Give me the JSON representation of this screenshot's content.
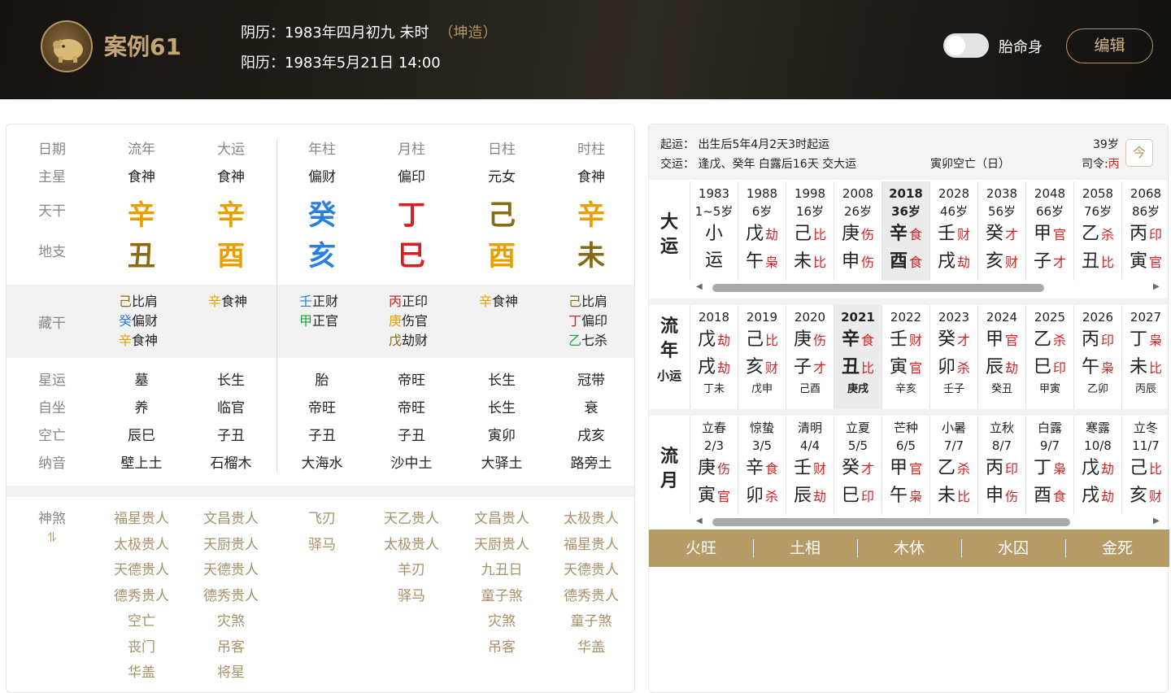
{
  "header": {
    "title": "案例61",
    "lunar": "阴历：1983年四月初九 未时",
    "gender": "（坤造）",
    "solar": "阳历：1983年5月21日 14:00",
    "toggle_label": "胎命身",
    "edit_label": "编辑"
  },
  "chart": {
    "labels": {
      "date": "日期",
      "main_star": "主星",
      "stem": "天干",
      "branch": "地支",
      "hidden": "藏干",
      "star_luck": "星运",
      "self_seat": "自坐",
      "void": "空亡",
      "nayin": "纳音",
      "shensha": "神煞",
      "shensha_icon": "⥮"
    },
    "columns": [
      {
        "head": "流年",
        "main": "食神",
        "stem": "辛",
        "stem_color": "#e8a000",
        "branch": "丑",
        "branch_color": "#8a6a10",
        "hidden": [
          {
            "g": "己",
            "ten": "比肩",
            "c": "#8a6a10"
          },
          {
            "g": "癸",
            "ten": "偏财",
            "c": "#2a7fe0"
          },
          {
            "g": "辛",
            "ten": "食神",
            "c": "#e8a000"
          }
        ],
        "star": "墓",
        "self": "养",
        "void": "辰巳",
        "nayin": "壁上土",
        "shensha": [
          "福星贵人",
          "太极贵人",
          "天德贵人",
          "德秀贵人",
          "空亡",
          "丧门",
          "华盖"
        ]
      },
      {
        "head": "大运",
        "main": "食神",
        "stem": "辛",
        "stem_color": "#e8a000",
        "branch": "酉",
        "branch_color": "#e8a000",
        "hidden": [
          {
            "g": "辛",
            "ten": "食神",
            "c": "#e8a000"
          }
        ],
        "star": "长生",
        "self": "临官",
        "void": "子丑",
        "nayin": "石榴木",
        "shensha": [
          "文昌贵人",
          "天厨贵人",
          "天德贵人",
          "德秀贵人",
          "灾煞",
          "吊客",
          "将星"
        ]
      },
      {
        "head": "年柱",
        "main": "偏财",
        "stem": "癸",
        "stem_color": "#2a7fe0",
        "branch": "亥",
        "branch_color": "#2a7fe0",
        "hidden": [
          {
            "g": "壬",
            "ten": "正财",
            "c": "#2a7fe0"
          },
          {
            "g": "甲",
            "ten": "正官",
            "c": "#1aa83c"
          }
        ],
        "star": "胎",
        "self": "帝旺",
        "void": "子丑",
        "nayin": "大海水",
        "shensha": [
          "飞刃",
          "驿马"
        ]
      },
      {
        "head": "月柱",
        "main": "偏印",
        "stem": "丁",
        "stem_color": "#d62020",
        "branch": "巳",
        "branch_color": "#d62020",
        "hidden": [
          {
            "g": "丙",
            "ten": "正印",
            "c": "#d62020"
          },
          {
            "g": "庚",
            "ten": "伤官",
            "c": "#e8a000"
          },
          {
            "g": "戊",
            "ten": "劫财",
            "c": "#8a6a10"
          }
        ],
        "star": "帝旺",
        "self": "帝旺",
        "void": "子丑",
        "nayin": "沙中土",
        "shensha": [
          "天乙贵人",
          "太极贵人",
          "羊刃",
          "驿马"
        ]
      },
      {
        "head": "日柱",
        "main": "元女",
        "stem": "己",
        "stem_color": "#8a6a10",
        "branch": "酉",
        "branch_color": "#e8a000",
        "hidden": [
          {
            "g": "辛",
            "ten": "食神",
            "c": "#e8a000"
          }
        ],
        "star": "长生",
        "self": "长生",
        "void": "寅卯",
        "nayin": "大驿土",
        "shensha": [
          "文昌贵人",
          "天厨贵人",
          "九丑日",
          "童子煞",
          "灾煞",
          "吊客"
        ]
      },
      {
        "head": "时柱",
        "main": "食神",
        "stem": "辛",
        "stem_color": "#e8a000",
        "branch": "未",
        "branch_color": "#8a6a10",
        "hidden": [
          {
            "g": "己",
            "ten": "比肩",
            "c": "#8a6a10"
          },
          {
            "g": "丁",
            "ten": "偏印",
            "c": "#d62020"
          },
          {
            "g": "乙",
            "ten": "七杀",
            "c": "#1aa83c"
          }
        ],
        "star": "冠带",
        "self": "衰",
        "void": "戌亥",
        "nayin": "路旁土",
        "shensha": [
          "太极贵人",
          "福星贵人",
          "天德贵人",
          "德秀贵人",
          "童子煞",
          "华盖"
        ]
      }
    ]
  },
  "fortune": {
    "qiyun": "起运：  出生后5年4月2天3时起运",
    "jiaoyun": "交运：  逢戊、癸年 白露后16天 交大运",
    "kongwang": "寅卯空亡（日）",
    "age": "39岁",
    "siling_label": "司令:",
    "siling_value": "丙",
    "cal_icon": "今",
    "dayun_label": [
      "大",
      "运"
    ],
    "dayun": [
      {
        "y": "1983",
        "a": "1~5岁",
        "g1": "小",
        "s1": "",
        "g2": "运",
        "s2": ""
      },
      {
        "y": "1988",
        "a": "6岁",
        "g1": "戊",
        "s1": "劫",
        "g2": "午",
        "s2": "枭"
      },
      {
        "y": "1998",
        "a": "16岁",
        "g1": "己",
        "s1": "比",
        "g2": "未",
        "s2": "比"
      },
      {
        "y": "2008",
        "a": "26岁",
        "g1": "庚",
        "s1": "伤",
        "g2": "申",
        "s2": "伤"
      },
      {
        "y": "2018",
        "a": "36岁",
        "g1": "辛",
        "s1": "食",
        "g2": "酉",
        "s2": "食",
        "cur": true
      },
      {
        "y": "2028",
        "a": "46岁",
        "g1": "壬",
        "s1": "财",
        "g2": "戌",
        "s2": "劫"
      },
      {
        "y": "2038",
        "a": "56岁",
        "g1": "癸",
        "s1": "才",
        "g2": "亥",
        "s2": "财"
      },
      {
        "y": "2048",
        "a": "66岁",
        "g1": "甲",
        "s1": "官",
        "g2": "子",
        "s2": "才"
      },
      {
        "y": "2058",
        "a": "76岁",
        "g1": "乙",
        "s1": "杀",
        "g2": "丑",
        "s2": "比"
      },
      {
        "y": "2068",
        "a": "86岁",
        "g1": "丙",
        "s1": "印",
        "g2": "寅",
        "s2": "官"
      }
    ],
    "liunian_label": [
      "流",
      "年"
    ],
    "xiaoyun_label": "小运",
    "liunian": [
      {
        "y": "2018",
        "g1": "戊",
        "s1": "劫",
        "g2": "戌",
        "s2": "劫",
        "x": "丁未"
      },
      {
        "y": "2019",
        "g1": "己",
        "s1": "比",
        "g2": "亥",
        "s2": "财",
        "x": "戊申"
      },
      {
        "y": "2020",
        "g1": "庚",
        "s1": "伤",
        "g2": "子",
        "s2": "才",
        "x": "己酉"
      },
      {
        "y": "2021",
        "g1": "辛",
        "s1": "食",
        "g2": "丑",
        "s2": "比",
        "x": "庚戌",
        "cur": true
      },
      {
        "y": "2022",
        "g1": "壬",
        "s1": "财",
        "g2": "寅",
        "s2": "官",
        "x": "辛亥"
      },
      {
        "y": "2023",
        "g1": "癸",
        "s1": "才",
        "g2": "卯",
        "s2": "杀",
        "x": "壬子"
      },
      {
        "y": "2024",
        "g1": "甲",
        "s1": "官",
        "g2": "辰",
        "s2": "劫",
        "x": "癸丑"
      },
      {
        "y": "2025",
        "g1": "乙",
        "s1": "杀",
        "g2": "巳",
        "s2": "印",
        "x": "甲寅"
      },
      {
        "y": "2026",
        "g1": "丙",
        "s1": "印",
        "g2": "午",
        "s2": "枭",
        "x": "乙卯"
      },
      {
        "y": "2027",
        "g1": "丁",
        "s1": "枭",
        "g2": "未",
        "s2": "比",
        "x": "丙辰"
      }
    ],
    "liuyue_label": [
      "流",
      "月"
    ],
    "liuyue": [
      {
        "t": "立春",
        "d": "2/3",
        "g1": "庚",
        "s1": "伤",
        "g2": "寅",
        "s2": "官"
      },
      {
        "t": "惊蛰",
        "d": "3/5",
        "g1": "辛",
        "s1": "食",
        "g2": "卯",
        "s2": "杀"
      },
      {
        "t": "清明",
        "d": "4/4",
        "g1": "壬",
        "s1": "财",
        "g2": "辰",
        "s2": "劫"
      },
      {
        "t": "立夏",
        "d": "5/5",
        "g1": "癸",
        "s1": "才",
        "g2": "巳",
        "s2": "印"
      },
      {
        "t": "芒种",
        "d": "6/5",
        "g1": "甲",
        "s1": "官",
        "g2": "午",
        "s2": "枭"
      },
      {
        "t": "小暑",
        "d": "7/7",
        "g1": "乙",
        "s1": "杀",
        "g2": "未",
        "s2": "比"
      },
      {
        "t": "立秋",
        "d": "8/7",
        "g1": "丙",
        "s1": "印",
        "g2": "申",
        "s2": "伤"
      },
      {
        "t": "白露",
        "d": "9/7",
        "g1": "丁",
        "s1": "枭",
        "g2": "酉",
        "s2": "食"
      },
      {
        "t": "寒露",
        "d": "10/8",
        "g1": "戊",
        "s1": "劫",
        "g2": "戌",
        "s2": "劫"
      },
      {
        "t": "立冬",
        "d": "11/7",
        "g1": "己",
        "s1": "比",
        "g2": "亥",
        "s2": "财"
      }
    ],
    "wuxing": [
      "火旺",
      "土相",
      "木休",
      "水囚",
      "金死"
    ]
  }
}
